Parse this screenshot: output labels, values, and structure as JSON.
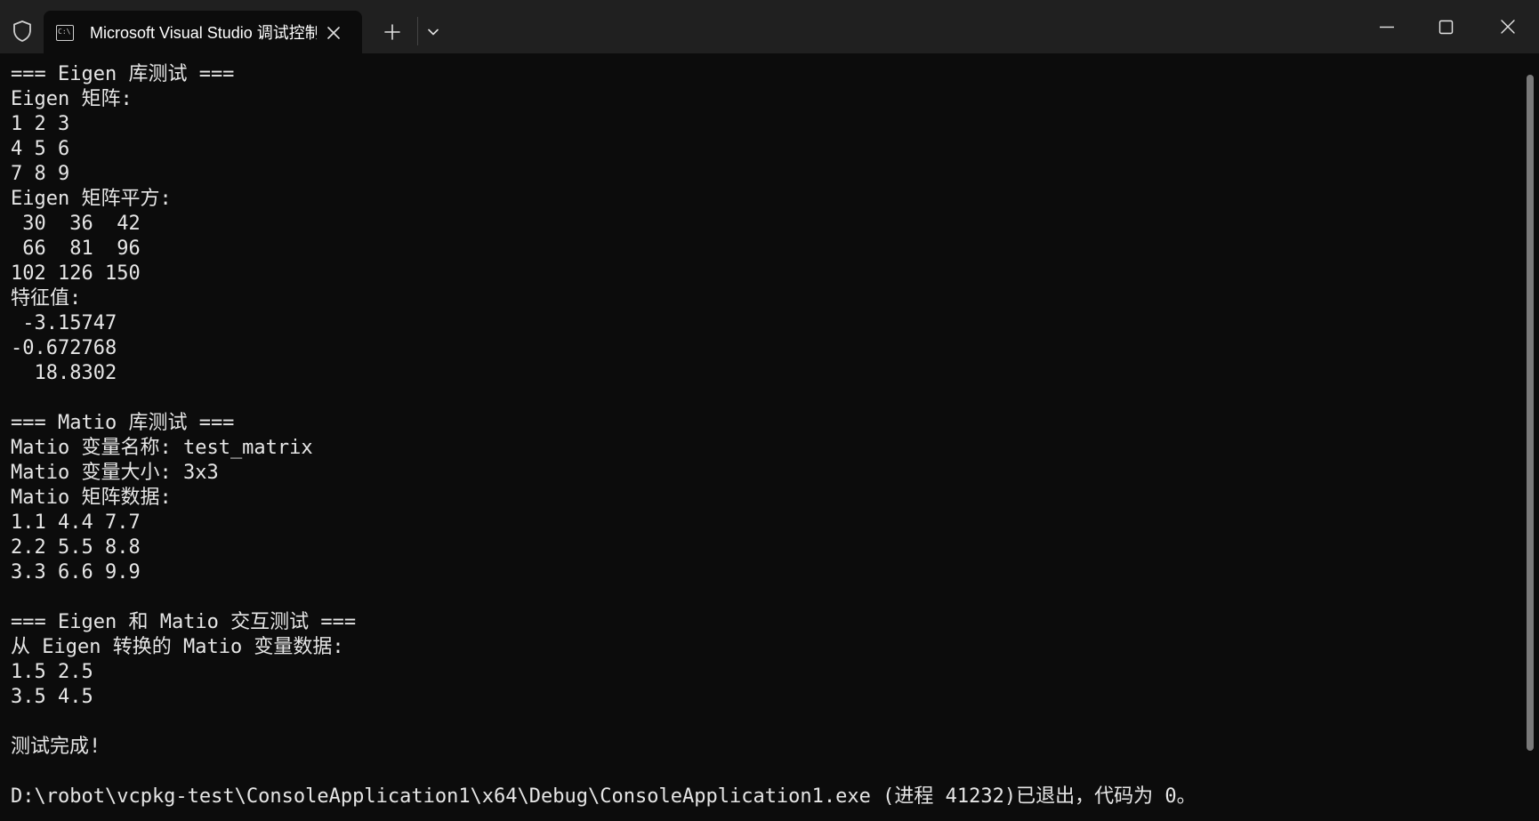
{
  "window": {
    "tab_title": "Microsoft Visual Studio 调试控制台",
    "tab_icon_text": "C:\\"
  },
  "console": {
    "lines": [
      "=== Eigen 库测试 ===",
      "Eigen 矩阵:",
      "1 2 3",
      "4 5 6",
      "7 8 9",
      "Eigen 矩阵平方:",
      " 30  36  42",
      " 66  81  96",
      "102 126 150",
      "特征值:",
      " -3.15747",
      "-0.672768",
      "  18.8302",
      "",
      "=== Matio 库测试 ===",
      "Matio 变量名称: test_matrix",
      "Matio 变量大小: 3x3",
      "Matio 矩阵数据:",
      "1.1 4.4 7.7",
      "2.2 5.5 8.8",
      "3.3 6.6 9.9",
      "",
      "=== Eigen 和 Matio 交互测试 ===",
      "从 Eigen 转换的 Matio 变量数据:",
      "1.5 2.5",
      "3.5 4.5",
      "",
      "测试完成!",
      "",
      "D:\\robot\\vcpkg-test\\ConsoleApplication1\\x64\\Debug\\ConsoleApplication1.exe (进程 41232)已退出，代码为 0。"
    ]
  },
  "colors": {
    "titlebar_bg": "#202020",
    "console_bg": "#0c0c0c",
    "console_text": "#e6e6e6",
    "scrollbar": "#7a7a7a"
  }
}
